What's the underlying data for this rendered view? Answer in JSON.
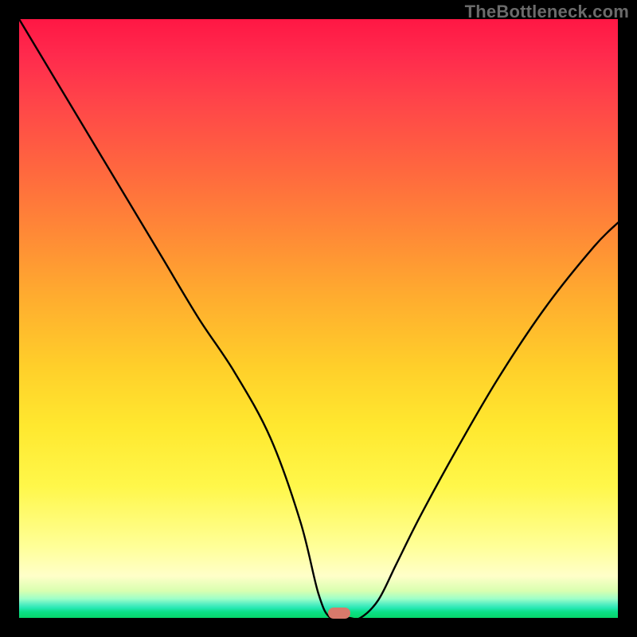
{
  "watermark": {
    "text": "TheBottleneck.com"
  },
  "chart_data": {
    "type": "line",
    "title": "",
    "xlabel": "",
    "ylabel": "",
    "xlim": [
      0,
      100
    ],
    "ylim": [
      0,
      100
    ],
    "legend": false,
    "grid": false,
    "background": "vertical-gradient red→yellow→green",
    "series": [
      {
        "name": "bottleneck-curve",
        "x": [
          0,
          6,
          12,
          18,
          24,
          30,
          36,
          42,
          47,
          50,
          52,
          55,
          57,
          60,
          63,
          67,
          73,
          80,
          88,
          96,
          100
        ],
        "y": [
          100,
          90,
          80,
          70,
          60,
          50,
          41,
          30,
          16,
          4,
          0,
          0,
          0,
          3,
          9,
          17,
          28,
          40,
          52,
          62,
          66
        ],
        "comment": "y is percent height from bottom; V-shaped curve with flat minimum near x≈52–57"
      }
    ],
    "marker": {
      "name": "optimum-marker",
      "x": 53.5,
      "y": 0.8,
      "shape": "pill",
      "color": "#d9796b"
    }
  }
}
